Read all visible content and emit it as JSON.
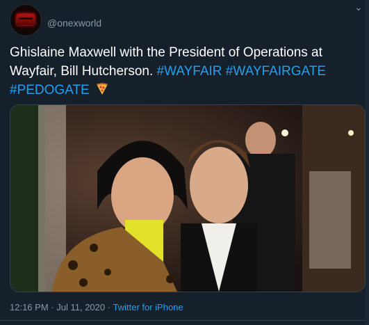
{
  "author": {
    "handle": "@onexworld"
  },
  "tweet": {
    "text": "Ghislaine Maxwell with the President of Operations at Wayfair, Bill Hutcherson.",
    "hashtags": [
      "#WAYFAIR",
      "#WAYFAIRGATE",
      "#PEDOGATE"
    ],
    "emoji": "pizza-icon"
  },
  "meta": {
    "time": "12:16 PM",
    "date": "Jul 11, 2020",
    "separator": "·",
    "source": "Twitter for iPhone"
  },
  "colors": {
    "background": "#15202b",
    "link": "#1da1f2",
    "muted": "#8899a6",
    "text": "#ffffff"
  }
}
